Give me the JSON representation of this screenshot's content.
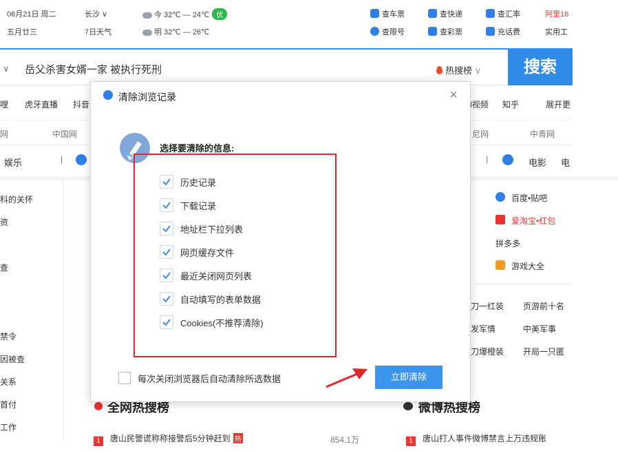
{
  "topbar": {
    "date": "06月21日 周二",
    "lunar": "五月廿三",
    "city": "长沙 ∨",
    "forecast7": "7日天气",
    "today": "今 32℃ — 24℃",
    "air": "优",
    "tomorrow": "明 32℃ — 26℃",
    "tools": [
      {
        "label": "查车票",
        "color": "#2f7fe6"
      },
      {
        "label": "查快递",
        "color": "#2f7fe6"
      },
      {
        "label": "查汇率",
        "color": "#2f7fe6"
      },
      {
        "label": "查限号",
        "color": "#2f7fe6"
      },
      {
        "label": "查彩票",
        "color": "#2f7fe6"
      },
      {
        "label": "充话费",
        "color": "#2f7fe6"
      }
    ],
    "ali": "阿里16",
    "shiyong": "实用工"
  },
  "search": {
    "caret": "∨",
    "query": "岳父杀害女婿一家 被执行死刑",
    "hot_label": "热搜榜",
    "hot_caret": "∨",
    "button": "搜索"
  },
  "background": {
    "nav_row": [
      "哩",
      "虎牙直播",
      "抖音",
      "l视频",
      "知乎",
      "展开更"
    ],
    "site_row": [
      "网",
      "中国网",
      "尼网",
      "中青网"
    ],
    "cat_row_left": [
      "娱乐",
      "|"
    ],
    "cat_row_right": [
      "|",
      "电影",
      "电"
    ],
    "left_list": [
      "科的关怀",
      "资",
      "查",
      "禁令",
      "因被查",
      "关系",
      "首付",
      "工作"
    ],
    "right_links": [
      "百度•贴吧",
      "爱淘宝•红包",
      "拼多多",
      "游戏大全"
    ],
    "right_links2": [
      "刀一红装",
      "页游前十名",
      "发军情",
      "中美军事",
      "刀爆橙装",
      "开局一只匿"
    ],
    "hot_title_left": "全网热搜榜",
    "hot_title_right": "微博热搜榜",
    "hot_item_left": "唐山民警谎称称接警后5分钟赶到",
    "hot_item_left_tag": "热",
    "hot_item_left_count": "854.1万",
    "hot_item_right": "唐山打人事件微博禁言上万违规账",
    "rank1": "1"
  },
  "dialog": {
    "title": "清除浏览记录",
    "close": "×",
    "section_label": "选择要清除的信息:",
    "options": [
      {
        "label": "历史记录",
        "checked": true
      },
      {
        "label": "下载记录",
        "checked": true
      },
      {
        "label": "地址栏下拉列表",
        "checked": true
      },
      {
        "label": "网页缓存文件",
        "checked": true
      },
      {
        "label": "最近关闭网页列表",
        "checked": true
      },
      {
        "label": "自动填写的表单数据",
        "checked": true
      },
      {
        "label": "Cookies(不推荐清除)",
        "checked": true
      }
    ],
    "auto_clear_label": "每次关闭浏览器后自动清除所选数据",
    "auto_clear_checked": false,
    "clear_button": "立即清除"
  },
  "colors": {
    "accent": "#3b95ec",
    "highlight_box": "#e0262a",
    "check": "#3b8ee6"
  }
}
